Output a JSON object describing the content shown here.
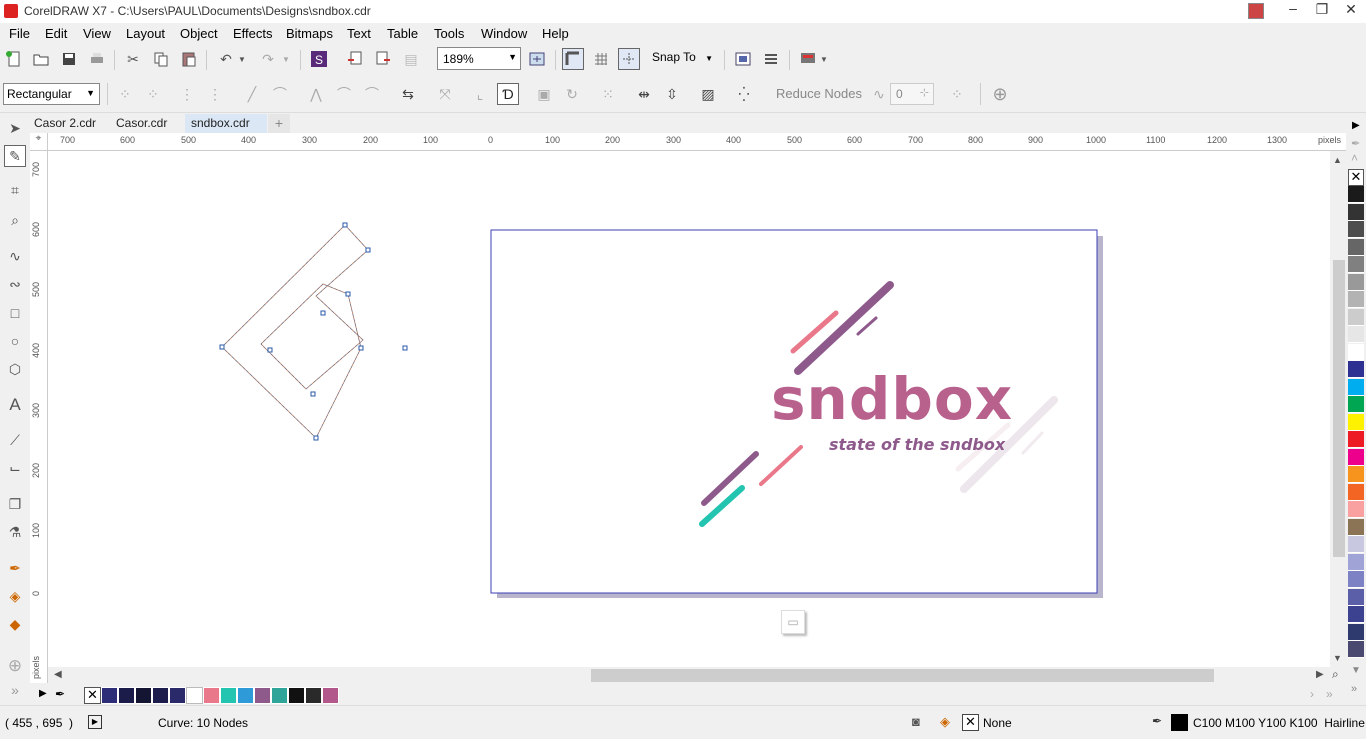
{
  "window": {
    "title": "CorelDRAW X7 - C:\\Users\\PAUL\\Documents\\Designs\\sndbox.cdr"
  },
  "menu": [
    "File",
    "Edit",
    "View",
    "Layout",
    "Object",
    "Effects",
    "Bitmaps",
    "Text",
    "Table",
    "Tools",
    "Window",
    "Help"
  ],
  "toolbar": {
    "zoom": "189%",
    "snap_label": "Snap To"
  },
  "propbar": {
    "selection_mode": "Rectangular",
    "reduce_nodes_label": "Reduce Nodes",
    "smoothness_value": "0"
  },
  "tabs": [
    {
      "label": "Casor 2.cdr",
      "active": false
    },
    {
      "label": "Casor.cdr",
      "active": false
    },
    {
      "label": "sndbox.cdr",
      "active": true
    }
  ],
  "ruler_h": {
    "ticks": [
      "700",
      "600",
      "500",
      "400",
      "300",
      "200",
      "100",
      "0",
      "100",
      "200",
      "300",
      "400",
      "500",
      "600",
      "700",
      "800",
      "900",
      "1000",
      "1100",
      "1200",
      "1300"
    ],
    "unit": "pixels"
  },
  "ruler_v": {
    "ticks": [
      "700",
      "600",
      "500",
      "400",
      "300",
      "200",
      "100",
      "0"
    ],
    "unit": "pixels"
  },
  "logo": {
    "wordmark": "sndbox",
    "tagline": "state of the sndbox"
  },
  "statusbar": {
    "coords": "( 455 , 695  )",
    "info": "Curve: 10 Nodes",
    "fill": "None",
    "outline": "C100 M100 Y100 K100  Hairline"
  },
  "doc_palette": [
    "#2e2e78",
    "#1c1c4a",
    "#141433",
    "#1d1d4d",
    "#2a2a6a",
    "#ffffff",
    "#e8788a",
    "#23c4b0",
    "#2e9ad8",
    "#8e5a8c",
    "#2fa59a",
    "#111111",
    "#2a2a2a",
    "#b2588a"
  ],
  "palette": [
    "#1a1a1a",
    "#333333",
    "#4d4d4d",
    "#666666",
    "#808080",
    "#999999",
    "#b3b3b3",
    "#cccccc",
    "#e6e6e6",
    "#ffffff",
    "#2e3192",
    "#00aeef",
    "#00a651",
    "#fff200",
    "#ed1c24",
    "#ec008c",
    "#f7941d",
    "#f26522",
    "#f9a0a0",
    "#8b7355",
    "#c8c8e0",
    "#9fa3d6",
    "#7c82c4",
    "#5b5fa8",
    "#3d4290",
    "#2e3a6e",
    "#4a4a70"
  ],
  "colors": {
    "brand_purple": "#8e5a8c",
    "brand_pink": "#e8788a",
    "brand_teal": "#23c4b0",
    "page_border": "#3e3eb4"
  }
}
